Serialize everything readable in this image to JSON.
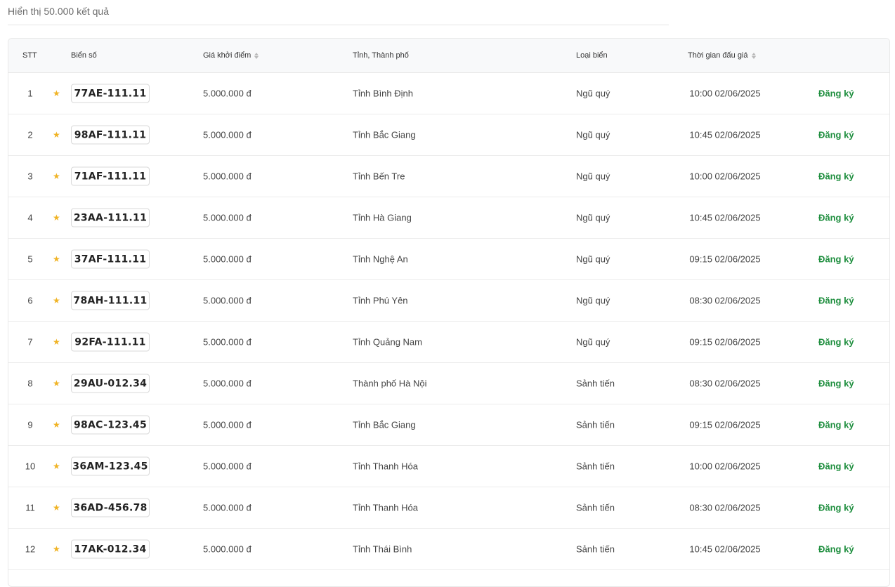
{
  "summary": {
    "result_count_text": "Hiển thị 50.000 kết quả"
  },
  "colors": {
    "star": "#f0b324",
    "register_link": "#1e8e3e"
  },
  "table": {
    "headers": {
      "stt": "STT",
      "plate": "Biển số",
      "price": "Giá khởi điểm",
      "province": "Tỉnh, Thành phố",
      "type": "Loại biển",
      "time": "Thời gian đấu giá"
    },
    "rows": [
      {
        "stt": "1",
        "plate": "77AE-111.11",
        "price": "5.000.000 đ",
        "province": "Tỉnh Bình Định",
        "type": "Ngũ quý",
        "time": "10:00 02/06/2025",
        "action": "Đăng ký"
      },
      {
        "stt": "2",
        "plate": "98AF-111.11",
        "price": "5.000.000 đ",
        "province": "Tỉnh Bắc Giang",
        "type": "Ngũ quý",
        "time": "10:45 02/06/2025",
        "action": "Đăng ký"
      },
      {
        "stt": "3",
        "plate": "71AF-111.11",
        "price": "5.000.000 đ",
        "province": "Tỉnh Bến Tre",
        "type": "Ngũ quý",
        "time": "10:00 02/06/2025",
        "action": "Đăng ký"
      },
      {
        "stt": "4",
        "plate": "23AA-111.11",
        "price": "5.000.000 đ",
        "province": "Tỉnh Hà Giang",
        "type": "Ngũ quý",
        "time": "10:45 02/06/2025",
        "action": "Đăng ký"
      },
      {
        "stt": "5",
        "plate": "37AF-111.11",
        "price": "5.000.000 đ",
        "province": "Tỉnh Nghệ An",
        "type": "Ngũ quý",
        "time": "09:15 02/06/2025",
        "action": "Đăng ký"
      },
      {
        "stt": "6",
        "plate": "78AH-111.11",
        "price": "5.000.000 đ",
        "province": "Tỉnh Phú Yên",
        "type": "Ngũ quý",
        "time": "08:30 02/06/2025",
        "action": "Đăng ký"
      },
      {
        "stt": "7",
        "plate": "92FA-111.11",
        "price": "5.000.000 đ",
        "province": "Tỉnh Quảng Nam",
        "type": "Ngũ quý",
        "time": "09:15 02/06/2025",
        "action": "Đăng ký"
      },
      {
        "stt": "8",
        "plate": "29AU-012.34",
        "price": "5.000.000 đ",
        "province": "Thành phố Hà Nội",
        "type": "Sảnh tiến",
        "time": "08:30 02/06/2025",
        "action": "Đăng ký"
      },
      {
        "stt": "9",
        "plate": "98AC-123.45",
        "price": "5.000.000 đ",
        "province": "Tỉnh Bắc Giang",
        "type": "Sảnh tiến",
        "time": "09:15 02/06/2025",
        "action": "Đăng ký"
      },
      {
        "stt": "10",
        "plate": "36AM-123.45",
        "price": "5.000.000 đ",
        "province": "Tỉnh Thanh Hóa",
        "type": "Sảnh tiến",
        "time": "10:00 02/06/2025",
        "action": "Đăng ký"
      },
      {
        "stt": "11",
        "plate": "36AD-456.78",
        "price": "5.000.000 đ",
        "province": "Tỉnh Thanh Hóa",
        "type": "Sảnh tiến",
        "time": "08:30 02/06/2025",
        "action": "Đăng ký"
      },
      {
        "stt": "12",
        "plate": "17AK-012.34",
        "price": "5.000.000 đ",
        "province": "Tỉnh Thái Bình",
        "type": "Sảnh tiến",
        "time": "10:45 02/06/2025",
        "action": "Đăng ký"
      }
    ]
  }
}
